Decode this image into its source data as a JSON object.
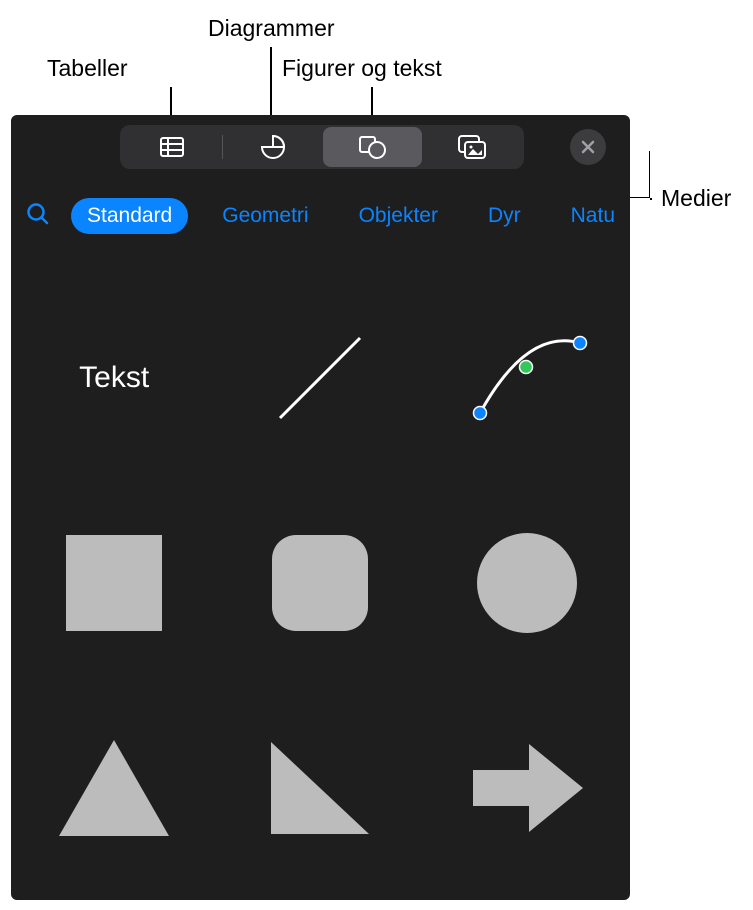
{
  "callouts": {
    "tables": "Tabeller",
    "charts": "Diagrammer",
    "shapes_text": "Figurer og tekst",
    "media": "Medier"
  },
  "categories": {
    "standard": "Standard",
    "geometry": "Geometri",
    "objects": "Objekter",
    "animals": "Dyr",
    "nature": "Natu"
  },
  "shapes": {
    "text_label": "Tekst"
  }
}
